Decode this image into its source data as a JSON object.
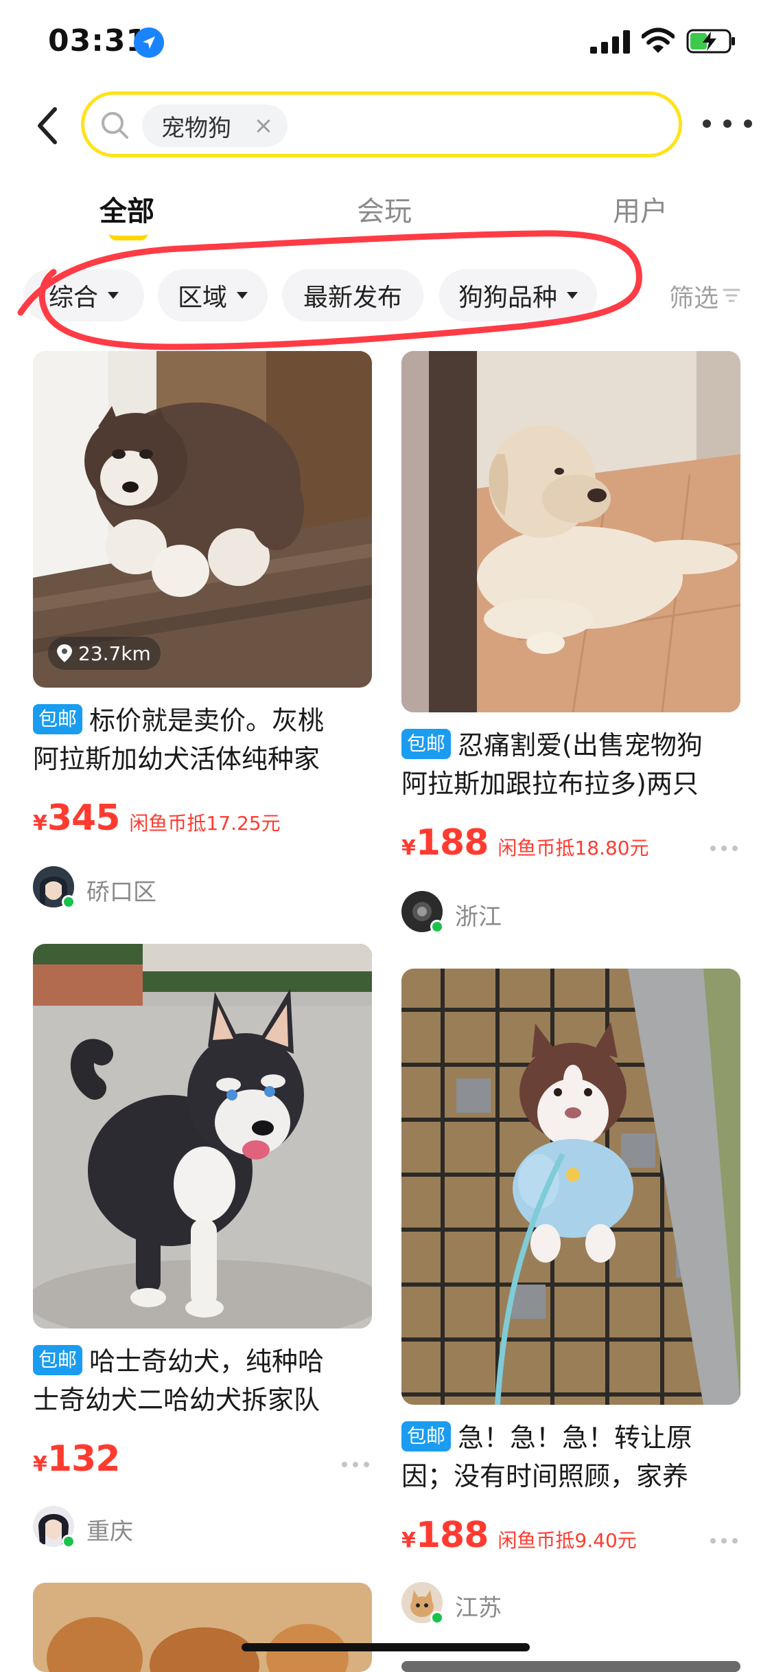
{
  "status_bar": {
    "time": "03:31",
    "icons": [
      "location-arrow-icon",
      "signal-icon",
      "wifi-icon",
      "battery-charging-icon"
    ]
  },
  "search": {
    "query_chip": "宠物狗",
    "clear_symbol": "×",
    "icons": [
      "back-chevron-icon",
      "search-icon",
      "clear-icon",
      "more-icon"
    ]
  },
  "tabs": [
    {
      "label": "全部",
      "active": true
    },
    {
      "label": "会玩",
      "active": false
    },
    {
      "label": "用户",
      "active": false
    }
  ],
  "filters": {
    "items": [
      "综合",
      "区域",
      "最新发布",
      "狗狗品种"
    ],
    "more_label": "筛选"
  },
  "colors": {
    "search_border": "#ffe21a",
    "price": "#ff3b30",
    "free_ship_badge": "#1a9cf0",
    "annotation_stroke": "#ff3b45",
    "online_dot": "#19c24a"
  },
  "listings": [
    {
      "distance": "23.7km",
      "badge": "包邮",
      "title_line1": "标价就是卖价。灰桃",
      "title_line2": "阿拉斯加幼犬活体纯种家",
      "price_symbol": "¥",
      "price": "345",
      "coin_note": "闲鱼币抵17.25元",
      "location": "硚口区"
    },
    {
      "badge": "包邮",
      "title_line1": "忍痛割爱(出售宠物狗",
      "title_line2": "阿拉斯加跟拉布拉多)两只",
      "price_symbol": "¥",
      "price": "188",
      "coin_note": "闲鱼币抵18.80元",
      "location": "浙江"
    },
    {
      "badge": "包邮",
      "title_line1": "哈士奇幼犬，纯种哈",
      "title_line2": "士奇幼犬二哈幼犬拆家队",
      "price_symbol": "¥",
      "price": "132",
      "location": "重庆"
    },
    {
      "badge": "包邮",
      "title_line1": "急！急！急！转让原",
      "title_line2": "因；没有时间照顾，家养",
      "price_symbol": "¥",
      "price": "188",
      "coin_note": "闲鱼币抵9.40元",
      "location": "江苏"
    }
  ]
}
